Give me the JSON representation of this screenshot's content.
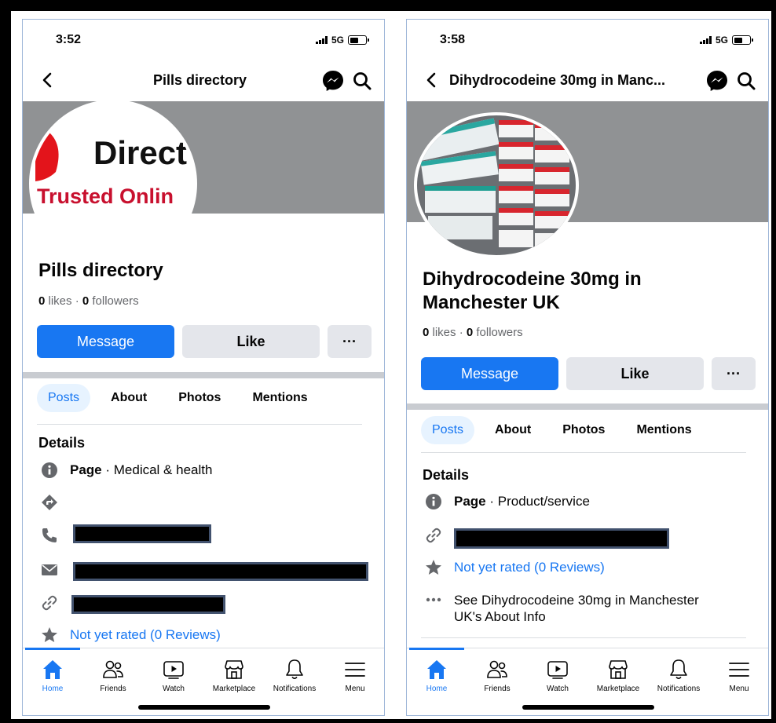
{
  "left": {
    "status_time": "3:52",
    "network": "5G",
    "header_title": "Pills directory",
    "avatar_text_top": "Direct",
    "avatar_text_bottom": "Trusted Onlin",
    "page_name": "Pills directory",
    "likes_count": "0",
    "likes_label": " likes",
    "followers_count": "0",
    "followers_label": " followers",
    "message_label": "Message",
    "like_label": "Like",
    "more_label": "···",
    "tabs": [
      "Posts",
      "About",
      "Photos",
      "Mentions"
    ],
    "details_title": "Details",
    "detail_page_bold": "Page",
    "detail_page_category": " · Medical & health",
    "rating_text": "Not yet rated (0 Reviews)"
  },
  "right": {
    "status_time": "3:58",
    "network": "5G",
    "header_title": "Dihydrocodeine 30mg in Manc...",
    "page_name_line1": "Dihydrocodeine 30mg in",
    "page_name_line2": "Manchester UK",
    "likes_count": "0",
    "likes_label": " likes",
    "followers_count": "0",
    "followers_label": " followers",
    "message_label": "Message",
    "like_label": "Like",
    "more_label": "···",
    "tabs": [
      "Posts",
      "About",
      "Photos",
      "Mentions"
    ],
    "details_title": "Details",
    "detail_page_bold": "Page",
    "detail_page_category": " · Product/service",
    "rating_text": "Not yet rated (0 Reviews)",
    "about_line1": "See Dihydrocodeine 30mg in Manchester",
    "about_line2": "UK's About Info"
  },
  "bottom_nav": [
    "Home",
    "Friends",
    "Watch",
    "Marketplace",
    "Notifications",
    "Menu"
  ],
  "colors": {
    "accent": "#1877f2",
    "cover": "#909294",
    "button_secondary": "#e4e6eb",
    "redaction_border": "#42526e"
  },
  "icons": [
    "back-arrow-icon",
    "messenger-icon",
    "search-icon",
    "info-icon",
    "directions-icon",
    "phone-icon",
    "mail-icon",
    "link-icon",
    "star-icon",
    "more-dots-icon",
    "home-icon",
    "friends-icon",
    "watch-icon",
    "marketplace-icon",
    "notifications-icon",
    "menu-icon"
  ]
}
